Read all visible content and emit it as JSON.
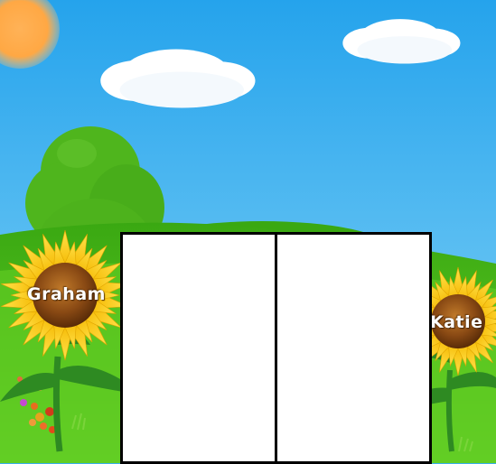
{
  "players": [
    {
      "name": "Graham",
      "flower": "sunflower-left"
    },
    {
      "name": "Katie",
      "flower": "sunflower-right"
    }
  ],
  "board": {
    "panels": [
      {
        "id": "left",
        "content": ""
      },
      {
        "id": "right",
        "content": ""
      }
    ]
  },
  "colors": {
    "sky_top": "#2aa6ee",
    "sky_bottom": "#7fd0f6",
    "sun": "#ffad4a",
    "grass": "#58c31a",
    "tree_foliage": "#4db21c",
    "tree_trunk": "#8b4513",
    "petal": "#ffcc1a",
    "flower_center": "#8b4a12"
  },
  "icons": [
    "sun-icon",
    "cloud-icon",
    "tree-icon",
    "sunflower-icon"
  ]
}
